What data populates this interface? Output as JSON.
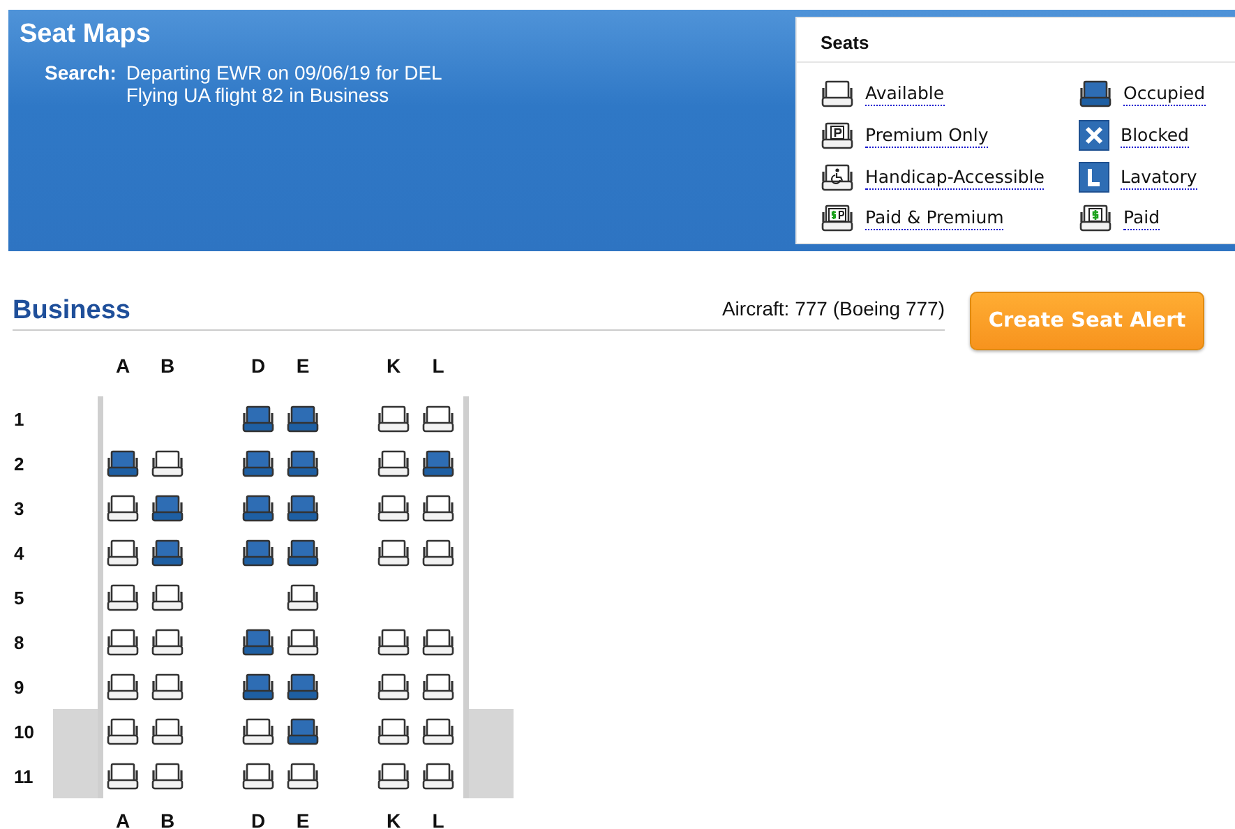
{
  "header": {
    "title": "Seat Maps",
    "search_label": "Search:",
    "search_lines": [
      "Departing EWR on 09/06/19 for DEL",
      "Flying UA flight 82 in Business"
    ]
  },
  "legend": {
    "title": "Seats",
    "items": [
      {
        "kind": "available",
        "label": "Available"
      },
      {
        "kind": "occupied",
        "label": "Occupied"
      },
      {
        "kind": "premium",
        "label": "Premium Only"
      },
      {
        "kind": "blocked",
        "label": "Blocked"
      },
      {
        "kind": "handicap",
        "label": "Handicap-Accessible"
      },
      {
        "kind": "lavatory",
        "label": "Lavatory"
      },
      {
        "kind": "paid-premium",
        "label": "Paid & Premium"
      },
      {
        "kind": "paid",
        "label": "Paid"
      }
    ]
  },
  "cabin": {
    "title": "Business",
    "aircraft": "Aircraft: 777 (Boeing 777)",
    "alert_button": "Create Seat Alert",
    "column_groups": [
      [
        "A",
        "B"
      ],
      [
        "D",
        "E"
      ],
      [
        "K",
        "L"
      ]
    ],
    "rows": [
      {
        "number": "1",
        "exit": false,
        "seats": [
          {
            "kind": "space"
          },
          {
            "kind": "space"
          },
          {
            "kind": "seat",
            "occupied": true
          },
          {
            "kind": "seat",
            "occupied": true
          },
          {
            "kind": "seat",
            "occupied": false
          },
          {
            "kind": "seat",
            "occupied": false
          }
        ]
      },
      {
        "number": "2",
        "exit": false,
        "seats": [
          {
            "kind": "seat",
            "occupied": true
          },
          {
            "kind": "seat",
            "occupied": false
          },
          {
            "kind": "seat",
            "occupied": true
          },
          {
            "kind": "seat",
            "occupied": true
          },
          {
            "kind": "seat",
            "occupied": false
          },
          {
            "kind": "seat",
            "occupied": true
          }
        ]
      },
      {
        "number": "3",
        "exit": false,
        "seats": [
          {
            "kind": "seat",
            "occupied": false
          },
          {
            "kind": "seat",
            "occupied": true
          },
          {
            "kind": "seat",
            "occupied": true
          },
          {
            "kind": "seat",
            "occupied": true
          },
          {
            "kind": "seat",
            "occupied": false
          },
          {
            "kind": "seat",
            "occupied": false
          }
        ]
      },
      {
        "number": "4",
        "exit": false,
        "seats": [
          {
            "kind": "seat",
            "occupied": false
          },
          {
            "kind": "seat",
            "occupied": true
          },
          {
            "kind": "seat",
            "occupied": true
          },
          {
            "kind": "seat",
            "occupied": true
          },
          {
            "kind": "seat",
            "occupied": false
          },
          {
            "kind": "seat",
            "occupied": false
          }
        ]
      },
      {
        "number": "5",
        "exit": false,
        "seats": [
          {
            "kind": "seat",
            "occupied": false
          },
          {
            "kind": "seat",
            "occupied": false
          },
          {
            "kind": "space"
          },
          {
            "kind": "seat",
            "occupied": false
          },
          {
            "kind": "space"
          },
          {
            "kind": "space"
          }
        ]
      },
      {
        "number": "8",
        "exit": false,
        "seats": [
          {
            "kind": "seat",
            "occupied": false
          },
          {
            "kind": "seat",
            "occupied": false
          },
          {
            "kind": "seat",
            "occupied": true
          },
          {
            "kind": "seat",
            "occupied": false
          },
          {
            "kind": "seat",
            "occupied": false
          },
          {
            "kind": "seat",
            "occupied": false
          }
        ]
      },
      {
        "number": "9",
        "exit": false,
        "seats": [
          {
            "kind": "seat",
            "occupied": false
          },
          {
            "kind": "seat",
            "occupied": false
          },
          {
            "kind": "seat",
            "occupied": true
          },
          {
            "kind": "seat",
            "occupied": true
          },
          {
            "kind": "seat",
            "occupied": false
          },
          {
            "kind": "seat",
            "occupied": false
          }
        ]
      },
      {
        "number": "10",
        "exit": true,
        "seats": [
          {
            "kind": "seat",
            "occupied": false
          },
          {
            "kind": "seat",
            "occupied": false
          },
          {
            "kind": "seat",
            "occupied": false
          },
          {
            "kind": "seat",
            "occupied": true
          },
          {
            "kind": "seat",
            "occupied": false
          },
          {
            "kind": "seat",
            "occupied": false
          }
        ]
      },
      {
        "number": "11",
        "exit": true,
        "seats": [
          {
            "kind": "seat",
            "occupied": false
          },
          {
            "kind": "seat",
            "occupied": false
          },
          {
            "kind": "seat",
            "occupied": false
          },
          {
            "kind": "seat",
            "occupied": false
          },
          {
            "kind": "seat",
            "occupied": false
          },
          {
            "kind": "seat",
            "occupied": false
          }
        ]
      }
    ],
    "footer_columns": [
      [
        "A",
        "B"
      ],
      [
        "D",
        "E"
      ],
      [
        "K",
        "L"
      ]
    ]
  }
}
